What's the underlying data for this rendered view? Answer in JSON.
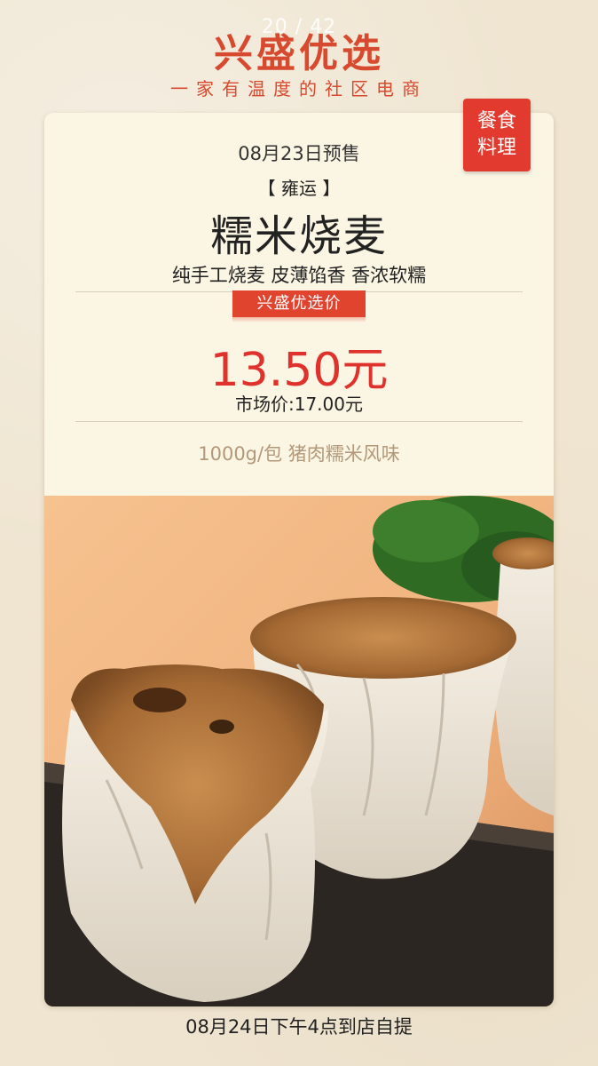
{
  "page_indicator": "20 / 42",
  "brand": {
    "title": "兴盛优选",
    "slogan": "一家有温度的社区电商"
  },
  "tag": {
    "line1": "餐食",
    "line2": "料理"
  },
  "product": {
    "presale_date": "08月23日预售",
    "origin": "【 雍运 】",
    "name": "糯米烧麦",
    "subtitle": "纯手工烧麦 皮薄馅香 香浓软糯",
    "price_label": "兴盛优选价",
    "price": "13.50元",
    "market_price": "市场价:17.00元",
    "spec": "1000g/包 猪肉糯米风味",
    "image_name": "glutinous-rice-shumai-photo"
  },
  "pickup_note": "08月24日下午4点到店自提",
  "colors": {
    "brand_red": "#d84a2f",
    "price_red": "#e0322c",
    "tag_red": "#e23a2e",
    "card_bg": "#fbf5e3",
    "page_bg": "#efe5d1",
    "spec_color": "#b3987a"
  }
}
